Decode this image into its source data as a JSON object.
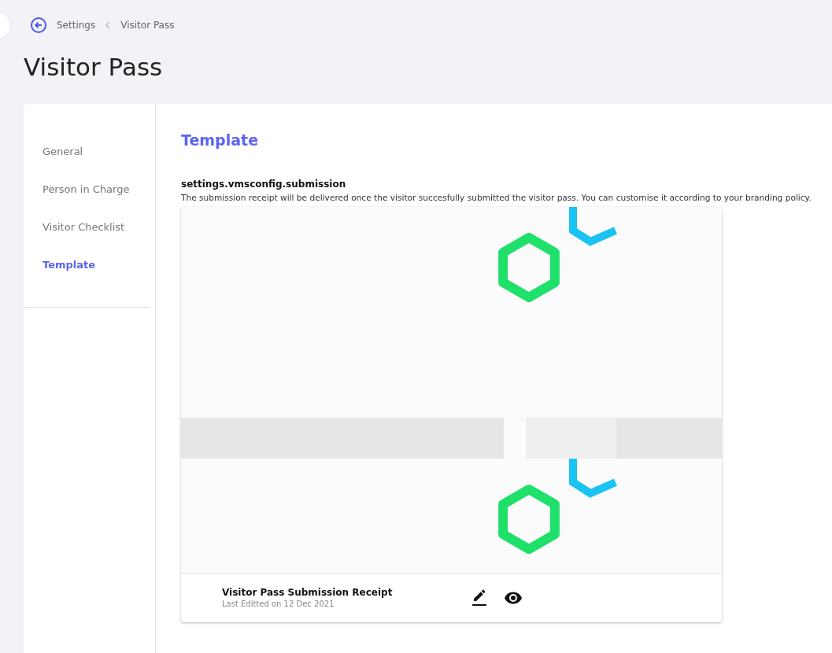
{
  "breadcrumb": {
    "items": [
      "Settings",
      "Visitor Pass"
    ]
  },
  "page_title": "Visitor Pass",
  "sidebar": {
    "items": [
      {
        "label": "General",
        "selected": false
      },
      {
        "label": "Person in Charge",
        "selected": false
      },
      {
        "label": "Visitor Checklist",
        "selected": false
      },
      {
        "label": "Template",
        "selected": true
      }
    ]
  },
  "section_title": "Template",
  "setting": {
    "key": "settings.vmsconfig.submission",
    "description": "The submission receipt will be delivered once the visitor succesfully submitted the visitor pass. You can customise it according to your branding policy."
  },
  "template_card": {
    "name": "Visitor Pass Submission Receipt",
    "edited": "Last Editted on 12 Dec 2021"
  }
}
